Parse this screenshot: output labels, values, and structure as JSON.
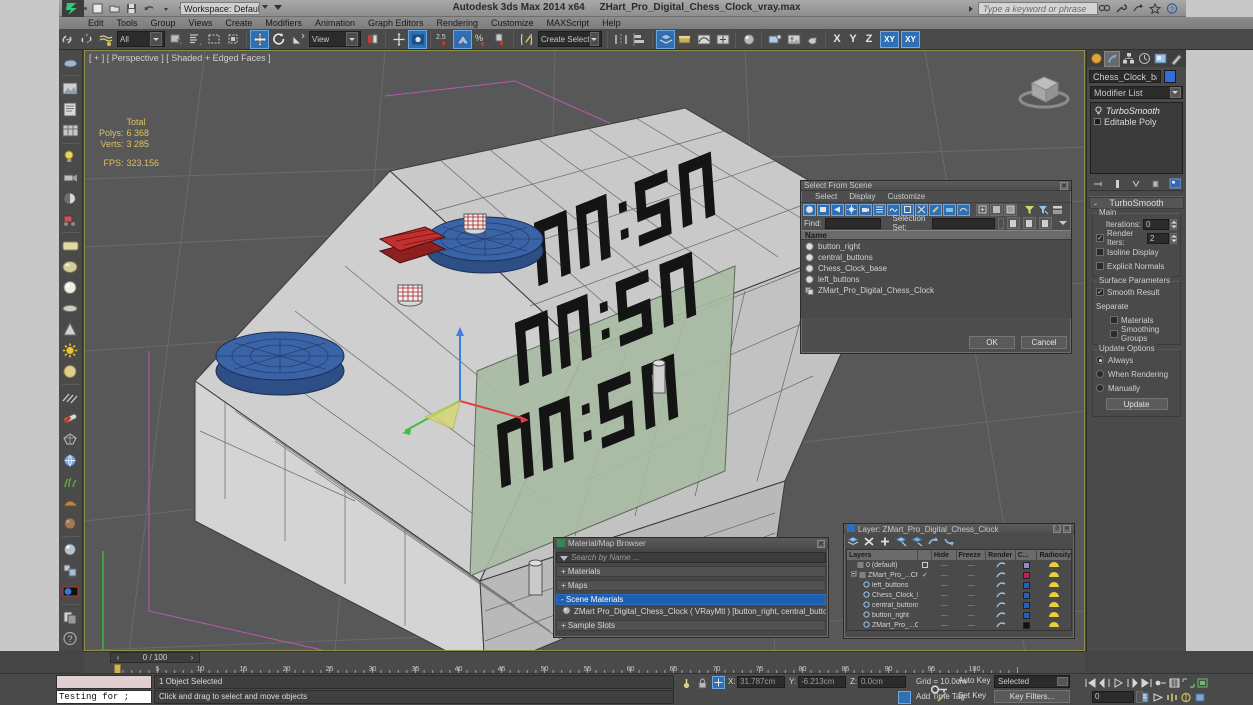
{
  "titlebar": {
    "app_title": "Autodesk 3ds Max  2014 x64",
    "file_name": "ZHart_Pro_Digital_Chess_Clock_vray.max",
    "workspace_label": "Workspace: Default",
    "search_placeholder": "Type a keyword or phrase",
    "minimize": "—",
    "restore": "❐",
    "close": "✕"
  },
  "menubar": {
    "items": [
      "Edit",
      "Tools",
      "Group",
      "Views",
      "Create",
      "Modifiers",
      "Animation",
      "Graph Editors",
      "Rendering",
      "Customize",
      "MAXScript",
      "Help"
    ]
  },
  "toolbar": {
    "selection_filter": "All",
    "reference_coord": "View",
    "named_selection": "Create Selection Se",
    "percent_snap": "2.5",
    "axis_x": "X",
    "axis_y": "Y",
    "axis_z": "Z",
    "axis_xy": "XY",
    "axis_xy2": "XY"
  },
  "viewport": {
    "label": "[ + ] [ Perspective ] [ Shaded + Edged Faces ]",
    "stats_header": "Total",
    "stats": [
      {
        "label": "Polys:",
        "value": "6 368"
      },
      {
        "label": "Verts:",
        "value": "3 285"
      }
    ],
    "fps_label": "FPS:",
    "fps_value": "323.156"
  },
  "command_panel": {
    "object_name": "Chess_Clock_base",
    "object_color": "#2c6fd6",
    "modifier_list_label": "Modifier List",
    "stack": [
      {
        "label": "TurboSmooth",
        "active": true
      },
      {
        "label": "Editable Poly",
        "active": false
      }
    ],
    "rollout_title": "TurboSmooth",
    "main_group": "Main",
    "iterations_label": "Iterations:",
    "iterations_value": "0",
    "render_iters_label": "Render Iters:",
    "render_iters_value": "2",
    "isoline_display": "Isoline Display",
    "explicit_normals": "Explicit Normals",
    "surface_params_group": "Surface Parameters",
    "smooth_result": "Smooth Result",
    "separate_label": "Separate",
    "separate_materials": "Materials",
    "separate_smoothing": "Smoothing Groups",
    "update_options_group": "Update Options",
    "update_always": "Always",
    "update_when_rendering": "When Rendering",
    "update_manually": "Manually",
    "update_button": "Update"
  },
  "select_from_scene": {
    "title": "Select From Scene",
    "close": "✕",
    "menu": [
      "Select",
      "Display",
      "Customize"
    ],
    "find_label": "Find:",
    "find_value": "",
    "selection_set_label": "Selection Set:",
    "selection_set_value": "",
    "column_name": "Name",
    "items": [
      {
        "name": "button_right"
      },
      {
        "name": "central_buttons"
      },
      {
        "name": "Chess_Clock_base"
      },
      {
        "name": "left_buttons"
      },
      {
        "name": "ZMart_Pro_Digital_Chess_Clock"
      }
    ],
    "ok_button": "OK",
    "cancel_button": "Cancel"
  },
  "material_browser": {
    "title": "Material/Map Browser",
    "close": "✕",
    "search_placeholder": "Search by Name ...",
    "groups": [
      {
        "label": "+ Materials",
        "selected": false
      },
      {
        "label": "+ Maps",
        "selected": false
      },
      {
        "label": "- Scene Materials",
        "selected": true
      }
    ],
    "scene_material": "ZMart Pro_Digital_Chess_Clock  ( VRayMtl ) [button_right, central_buttons, Ches...",
    "sample_slots": "+ Sample Slots"
  },
  "layers_dialog": {
    "title": "Layer: ZMart_Pro_Digital_Chess_Clock",
    "help_button": "?",
    "close_button": "✕",
    "columns": [
      "Layers",
      "",
      "Hide",
      "Freeze",
      "Render",
      "C...",
      "Radiosity"
    ],
    "rows": [
      {
        "name": "0 (default)",
        "indent": 1,
        "hide": "—",
        "freeze": "—",
        "color": "#8c8cc8",
        "current": false
      },
      {
        "name": "ZMart_Pro_...Chess",
        "indent": 1,
        "hide": "—",
        "freeze": "—",
        "color": "#c21c5a",
        "current": true
      },
      {
        "name": "left_buttons",
        "indent": 2,
        "hide": "—",
        "freeze": "—",
        "color": "#1d63c4",
        "current": false
      },
      {
        "name": "Chess_Clock_ba",
        "indent": 2,
        "hide": "—",
        "freeze": "—",
        "color": "#1d63c4",
        "current": false
      },
      {
        "name": "central_buttons",
        "indent": 2,
        "hide": "—",
        "freeze": "—",
        "color": "#1d63c4",
        "current": false
      },
      {
        "name": "button_right",
        "indent": 2,
        "hide": "—",
        "freeze": "—",
        "color": "#1d63c4",
        "current": false
      },
      {
        "name": "ZMart_Pro_...Cl",
        "indent": 2,
        "hide": "—",
        "freeze": "—",
        "color": "#111111",
        "current": false
      }
    ]
  },
  "trackbar": {
    "frame_display": "0 / 100",
    "prev_arrow": "‹",
    "next_arrow": "›",
    "ruler_labels": [
      "5",
      "10",
      "15",
      "20",
      "25",
      "30",
      "35",
      "40",
      "45",
      "50",
      "55",
      "60",
      "65",
      "70",
      "75",
      "80",
      "85",
      "90",
      "95",
      "100"
    ]
  },
  "statusbar": {
    "listener_text": "Testing for ;",
    "status_text": "1 Object Selected",
    "prompt_text": "Click and drag to select and move objects",
    "coord_x_label": "X:",
    "coord_x_value": "31.787cm",
    "coord_y_label": "Y:",
    "coord_y_value": "-6.213cm",
    "coord_z_label": "Z:",
    "coord_z_value": "0.0cm",
    "grid_text": "Grid = 10.0cm",
    "add_time_tag": "Add Time Tag",
    "auto_key": "Auto Key",
    "set_key": "Set Key",
    "selection_mode": "Selected",
    "key_filters": "Key Filters...",
    "key_spinner": "0"
  }
}
